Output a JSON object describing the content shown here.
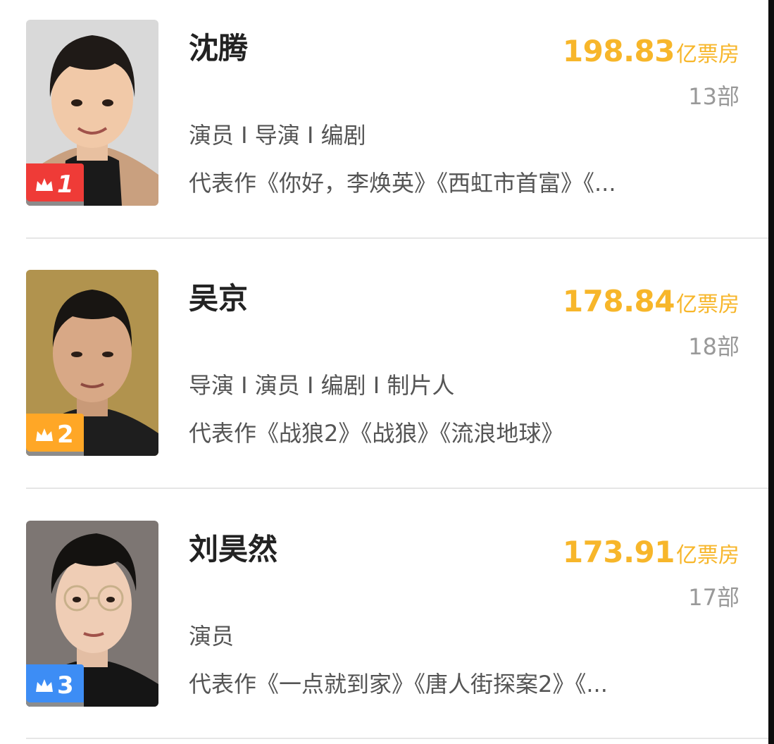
{
  "list": [
    {
      "rank": "1",
      "name": "沈腾",
      "box_office": "198.83",
      "box_unit": "亿票房",
      "film_count": "13部",
      "roles": "演员 I 导演 I 编剧",
      "works": "代表作《你好，李焕英》《西虹市首富》《...",
      "badge_color": "#ef3b37"
    },
    {
      "rank": "2",
      "name": "吴京",
      "box_office": "178.84",
      "box_unit": "亿票房",
      "film_count": "18部",
      "roles": "导演 I 演员 I 编剧 I 制片人",
      "works": "代表作《战狼2》《战狼》《流浪地球》",
      "badge_color": "#ffa726"
    },
    {
      "rank": "3",
      "name": "刘昊然",
      "box_office": "173.91",
      "box_unit": "亿票房",
      "film_count": "17部",
      "roles": "演员",
      "works": "代表作《一点就到家》《唐人街探案2》《...",
      "badge_color": "#3d8df5"
    }
  ],
  "colors": {
    "accent": "#f7b62a",
    "text_primary": "#222222",
    "text_secondary": "#555555",
    "text_muted": "#999999"
  }
}
